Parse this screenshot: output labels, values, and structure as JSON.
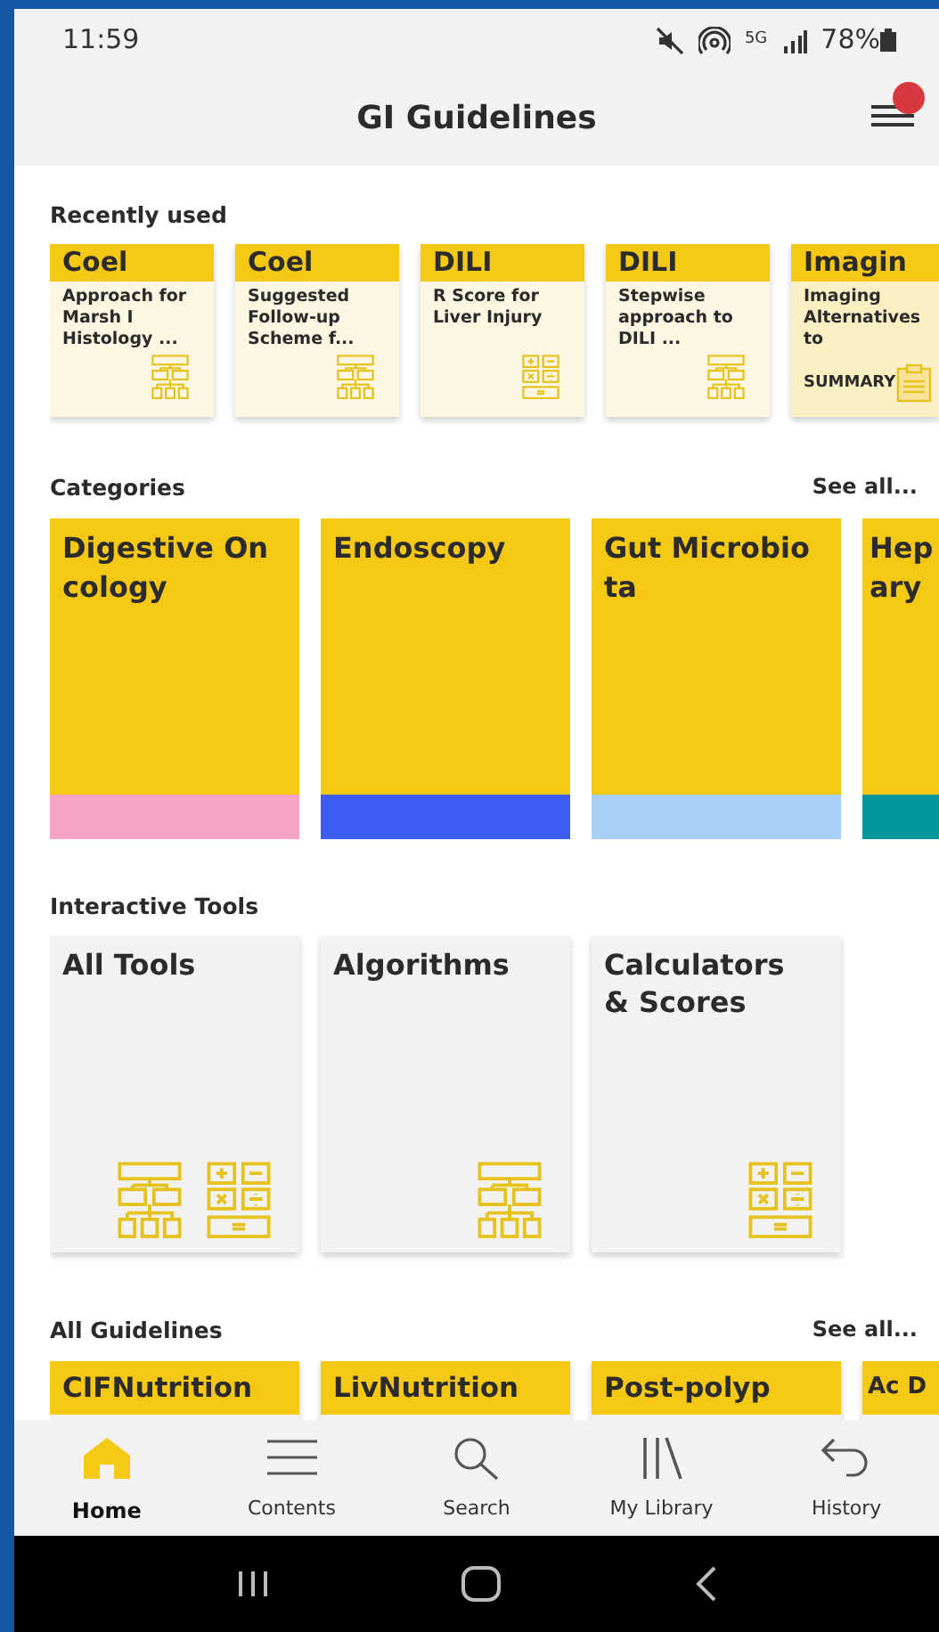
{
  "status_bar": {
    "time": "11:59",
    "network": "5G",
    "battery": "78%"
  },
  "app_bar": {
    "title": "GI Guidelines",
    "notification": true
  },
  "recently_used": {
    "title": "Recently used",
    "items": [
      {
        "tag": "Coel",
        "text": "Approach for Marsh I Histology ...",
        "kind": "algorithm"
      },
      {
        "tag": "Coel",
        "text": "Suggested Follow-up Scheme f...",
        "kind": "algorithm"
      },
      {
        "tag": "DILI",
        "text": "R Score for Liver Injury",
        "kind": "calculator"
      },
      {
        "tag": "DILI",
        "text": "Stepwise approach to DILI ...",
        "kind": "algorithm"
      },
      {
        "tag": "Imagin",
        "text": "Imaging Alternatives to",
        "kind": "summary",
        "label": "SUMMARY"
      }
    ]
  },
  "categories": {
    "title": "Categories",
    "see_all": "See all...",
    "items": [
      {
        "title_lines": [
          "Digestive On",
          "cology"
        ],
        "color": "#f4a3c4"
      },
      {
        "title_lines": [
          "Endoscopy"
        ],
        "color": "#3d5cf2"
      },
      {
        "title_lines": [
          "Gut Microbio",
          "ta"
        ],
        "color": "#a6d0f5"
      },
      {
        "title_lines": [
          "Hep",
          "ary"
        ],
        "color": "#00979c"
      }
    ]
  },
  "interactive_tools": {
    "title": "Interactive Tools",
    "items": [
      {
        "title": "All Tools",
        "kind": "all"
      },
      {
        "title": "Algorithms",
        "kind": "algorithm"
      },
      {
        "title": "Calculators & Scores",
        "kind": "calculator"
      }
    ]
  },
  "all_guidelines": {
    "title": "All Guidelines",
    "see_all": "See all...",
    "items": [
      {
        "title": "CIFNutrition"
      },
      {
        "title": "LivNutrition"
      },
      {
        "title": "Post-polyp"
      },
      {
        "title": "Ac D"
      }
    ]
  },
  "bottom_nav": [
    {
      "label": "Home",
      "kind": "home",
      "selected": true
    },
    {
      "label": "Contents",
      "kind": "contents",
      "selected": false
    },
    {
      "label": "Search",
      "kind": "search",
      "selected": false
    },
    {
      "label": "My Library",
      "kind": "library",
      "selected": false
    },
    {
      "label": "History",
      "kind": "history",
      "selected": false
    }
  ]
}
